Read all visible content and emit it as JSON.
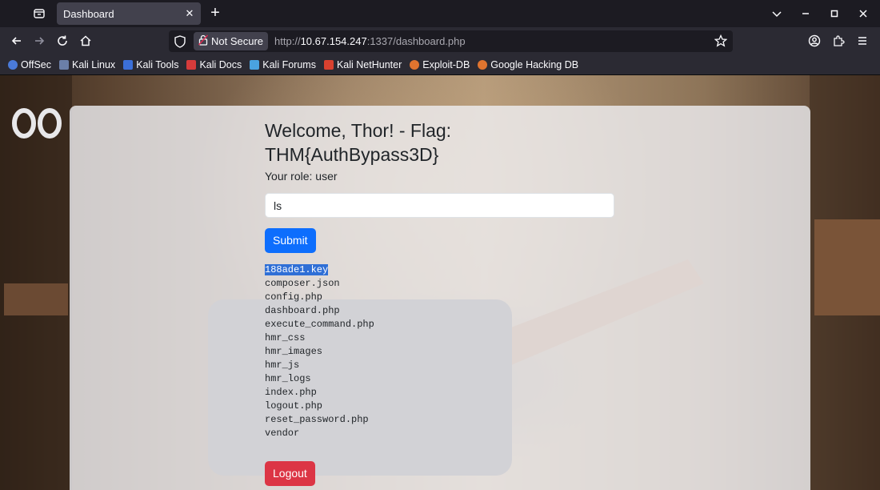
{
  "browser": {
    "tab_title": "Dashboard",
    "url_scheme": "http://",
    "url_host": "10.67.154.247",
    "url_rest": ":1337/dashboard.php",
    "not_secure_label": "Not Secure"
  },
  "bookmarks": [
    {
      "label": "OffSec",
      "icon": "offsec-icon",
      "color": "#4a7ad9"
    },
    {
      "label": "Kali Linux",
      "icon": "kali-dragon-icon",
      "color": "#6b7fa8"
    },
    {
      "label": "Kali Tools",
      "icon": "kali-tools-icon",
      "color": "#3b6fd8"
    },
    {
      "label": "Kali Docs",
      "icon": "kali-docs-icon",
      "color": "#d63b3b"
    },
    {
      "label": "Kali Forums",
      "icon": "kali-forums-icon",
      "color": "#4aa3e0"
    },
    {
      "label": "Kali NetHunter",
      "icon": "nethunter-icon",
      "color": "#d9412f"
    },
    {
      "label": "Exploit-DB",
      "icon": "exploit-db-icon",
      "color": "#e0742f"
    },
    {
      "label": "Google Hacking DB",
      "icon": "ghdb-icon",
      "color": "#e0742f"
    }
  ],
  "page": {
    "welcome_line1": "Welcome, Thor! - Flag:",
    "welcome_line2": "THM{AuthBypass3D}",
    "role_text": "Your role: user",
    "command_value": "ls",
    "submit_label": "Submit",
    "output_files": [
      "188ade1.key",
      "composer.json",
      "config.php",
      "dashboard.php",
      "execute_command.php",
      "hmr_css",
      "hmr_images",
      "hmr_js",
      "hmr_logs",
      "index.php",
      "logout.php",
      "reset_password.php",
      "vendor"
    ],
    "logout_label": "Logout"
  },
  "colors": {
    "primary": "#0d6efd",
    "danger": "#dc3545",
    "selection": "#2f6fd6"
  }
}
